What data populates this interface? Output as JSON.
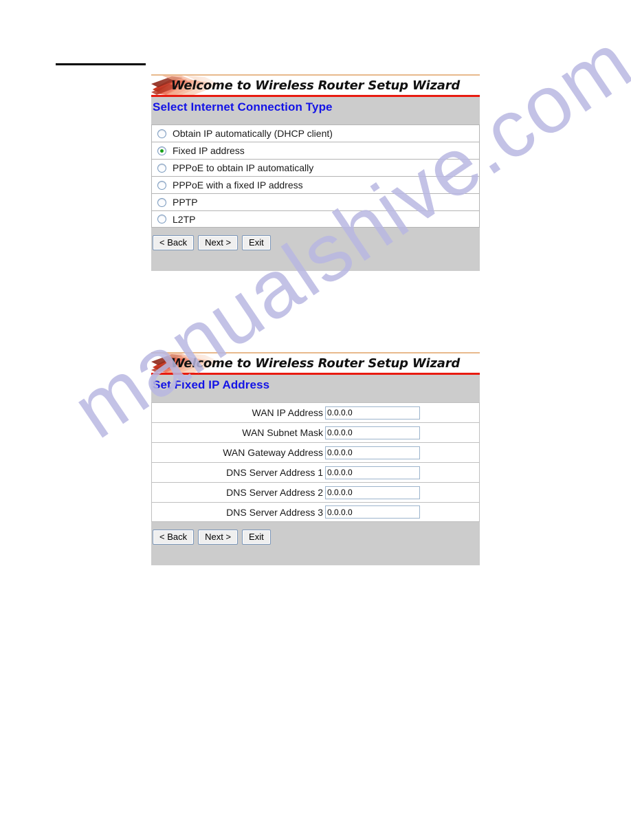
{
  "watermark": {
    "text": "manualshive.com"
  },
  "banner": {
    "title": "Welcome to Wireless Router Setup Wizard"
  },
  "colors": {
    "heading": "#1414e6",
    "banner_rule_top": "#e8b98c",
    "banner_rule_bottom": "#e81b10",
    "panel_background": "#cccccc",
    "radio_selected": "#18a018",
    "watermark": "#b9b8e2"
  },
  "buttons": {
    "back": "< Back",
    "next": "Next >",
    "exit": "Exit"
  },
  "panels": [
    {
      "heading": "Select Internet Connection Type",
      "options": [
        {
          "label": "Obtain IP automatically (DHCP client)",
          "selected": false
        },
        {
          "label": "Fixed IP address",
          "selected": true
        },
        {
          "label": "PPPoE to obtain IP automatically",
          "selected": false
        },
        {
          "label": "PPPoE with a fixed IP address",
          "selected": false
        },
        {
          "label": "PPTP",
          "selected": false
        },
        {
          "label": "L2TP",
          "selected": false
        }
      ]
    },
    {
      "heading": "Set Fixed IP Address",
      "fields": [
        {
          "label": "WAN IP Address",
          "value": "0.0.0.0"
        },
        {
          "label": "WAN Subnet Mask",
          "value": "0.0.0.0"
        },
        {
          "label": "WAN Gateway Address",
          "value": "0.0.0.0"
        },
        {
          "label": "DNS Server Address 1",
          "value": "0.0.0.0"
        },
        {
          "label": "DNS Server Address 2",
          "value": "0.0.0.0"
        },
        {
          "label": "DNS Server Address 3",
          "value": "0.0.0.0"
        }
      ]
    }
  ]
}
